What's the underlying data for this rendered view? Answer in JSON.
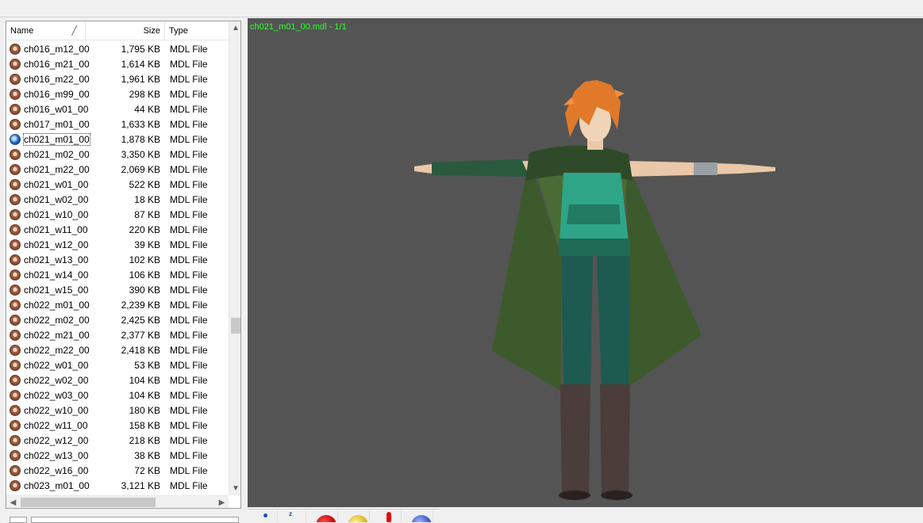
{
  "file_list": {
    "columns": {
      "name": "Name",
      "size": "Size",
      "type": "Type"
    },
    "sort_indicator": "╱",
    "rows": [
      {
        "name": "ch016_m12_00",
        "size": "1,795 KB",
        "type": "MDL File",
        "icon": "character-face-icon"
      },
      {
        "name": "ch016_m21_00",
        "size": "1,614 KB",
        "type": "MDL File",
        "icon": "character-face-icon"
      },
      {
        "name": "ch016_m22_00",
        "size": "1,961 KB",
        "type": "MDL File",
        "icon": "character-face-icon"
      },
      {
        "name": "ch016_m99_00",
        "size": "298 KB",
        "type": "MDL File",
        "icon": "character-face-icon"
      },
      {
        "name": "ch016_w01_00",
        "size": "44 KB",
        "type": "MDL File",
        "icon": "character-face-icon"
      },
      {
        "name": "ch017_m01_00",
        "size": "1,633 KB",
        "type": "MDL File",
        "icon": "character-face-icon"
      },
      {
        "name": "ch021_m01_00",
        "size": "1,878 KB",
        "type": "MDL File",
        "icon": "globe-icon",
        "selected": true
      },
      {
        "name": "ch021_m02_00",
        "size": "3,350 KB",
        "type": "MDL File",
        "icon": "character-face-icon"
      },
      {
        "name": "ch021_m22_00",
        "size": "2,069 KB",
        "type": "MDL File",
        "icon": "character-face-icon"
      },
      {
        "name": "ch021_w01_00",
        "size": "522 KB",
        "type": "MDL File",
        "icon": "character-face-icon"
      },
      {
        "name": "ch021_w02_00",
        "size": "18 KB",
        "type": "MDL File",
        "icon": "character-face-icon"
      },
      {
        "name": "ch021_w10_00",
        "size": "87 KB",
        "type": "MDL File",
        "icon": "character-face-icon"
      },
      {
        "name": "ch021_w11_00",
        "size": "220 KB",
        "type": "MDL File",
        "icon": "character-face-icon"
      },
      {
        "name": "ch021_w12_00",
        "size": "39 KB",
        "type": "MDL File",
        "icon": "character-face-icon"
      },
      {
        "name": "ch021_w13_00",
        "size": "102 KB",
        "type": "MDL File",
        "icon": "character-face-icon"
      },
      {
        "name": "ch021_w14_00",
        "size": "106 KB",
        "type": "MDL File",
        "icon": "character-face-icon"
      },
      {
        "name": "ch021_w15_00",
        "size": "390 KB",
        "type": "MDL File",
        "icon": "character-face-icon"
      },
      {
        "name": "ch022_m01_00",
        "size": "2,239 KB",
        "type": "MDL File",
        "icon": "character-face-icon"
      },
      {
        "name": "ch022_m02_00",
        "size": "2,425 KB",
        "type": "MDL File",
        "icon": "character-face-icon"
      },
      {
        "name": "ch022_m21_00",
        "size": "2,377 KB",
        "type": "MDL File",
        "icon": "character-face-icon"
      },
      {
        "name": "ch022_m22_00",
        "size": "2,418 KB",
        "type": "MDL File",
        "icon": "character-face-icon"
      },
      {
        "name": "ch022_w01_00",
        "size": "53 KB",
        "type": "MDL File",
        "icon": "character-face-icon"
      },
      {
        "name": "ch022_w02_00",
        "size": "104 KB",
        "type": "MDL File",
        "icon": "character-face-icon"
      },
      {
        "name": "ch022_w03_00",
        "size": "104 KB",
        "type": "MDL File",
        "icon": "character-face-icon"
      },
      {
        "name": "ch022_w10_00",
        "size": "180 KB",
        "type": "MDL File",
        "icon": "character-face-icon"
      },
      {
        "name": "ch022_w11_00",
        "size": "158 KB",
        "type": "MDL File",
        "icon": "character-face-icon"
      },
      {
        "name": "ch022_w12_00",
        "size": "218 KB",
        "type": "MDL File",
        "icon": "character-face-icon"
      },
      {
        "name": "ch022_w13_00",
        "size": "38 KB",
        "type": "MDL File",
        "icon": "character-face-icon"
      },
      {
        "name": "ch022_w16_00",
        "size": "72 KB",
        "type": "MDL File",
        "icon": "character-face-icon"
      },
      {
        "name": "ch023_m01_00",
        "size": "3,121 KB",
        "type": "MDL File",
        "icon": "character-face-icon"
      }
    ]
  },
  "viewport": {
    "title": "ch021_m01_00.mdl - 1/1",
    "title_color": "#2cff2c",
    "background": "#545454"
  },
  "toolbar": {
    "icons": [
      "point-mode-icon",
      "axis-icon",
      "red-sphere-icon",
      "yellow-sphere-icon",
      "light-icon",
      "blue-sphere-icon"
    ]
  }
}
